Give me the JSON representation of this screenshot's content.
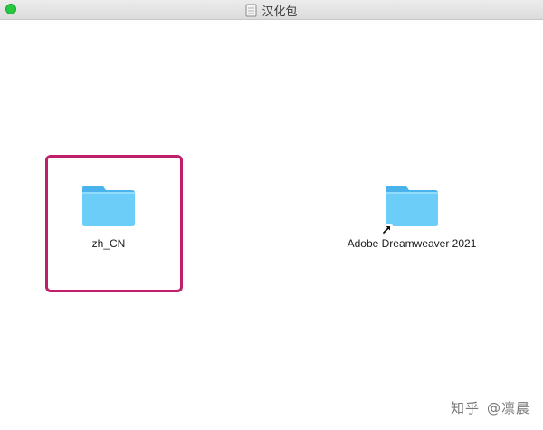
{
  "window": {
    "title": "汉化包"
  },
  "items": [
    {
      "label": "zh_CN"
    },
    {
      "label": "Adobe Dreamweaver 2021"
    }
  ],
  "watermark": {
    "site": "知乎",
    "user": "@凛晨"
  },
  "colors": {
    "folder": "#5ec4f5",
    "highlight": "#c0206a",
    "close_button": "#28c840"
  }
}
